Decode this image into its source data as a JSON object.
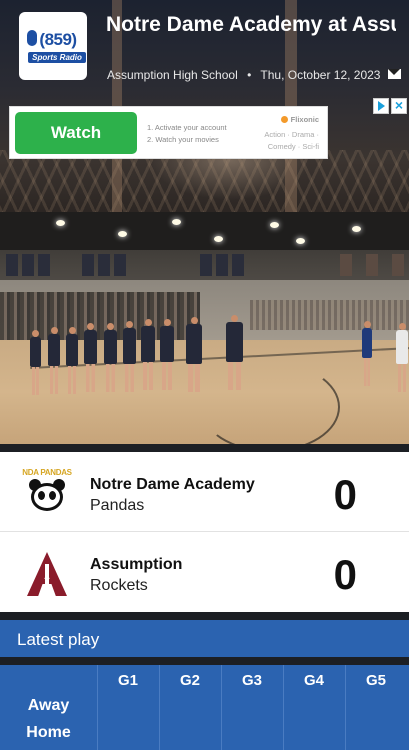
{
  "header": {
    "logo_number": "(859)",
    "logo_sub": "Sports Radio",
    "title": "Notre Dame Academy at Assumption Volleybal",
    "venue": "Assumption High School",
    "separator": "•",
    "date": "Thu, October 12, 2023",
    "share_icon": "mail-icon"
  },
  "ad": {
    "watch_label": "Watch",
    "step1": "1. Activate your account",
    "step2": "2. Watch your movies",
    "brand": "Flixonic",
    "genres": "Action · Drama · Comedy · Sci-fi"
  },
  "teams": [
    {
      "name": "Notre Dame Academy",
      "mascot": "Pandas",
      "score": "0",
      "logo_text": "NDA PANDAS"
    },
    {
      "name": "Assumption",
      "mascot": "Rockets",
      "score": "0"
    }
  ],
  "latest_play": {
    "label": "Latest play"
  },
  "linescore": {
    "games": [
      "G1",
      "G2",
      "G3",
      "G4",
      "G5"
    ],
    "rows": [
      "Away",
      "Home"
    ]
  },
  "colors": {
    "accent_blue": "#2b63b0",
    "watch_green": "#2db14b",
    "assumption_maroon": "#8a1c2b"
  }
}
